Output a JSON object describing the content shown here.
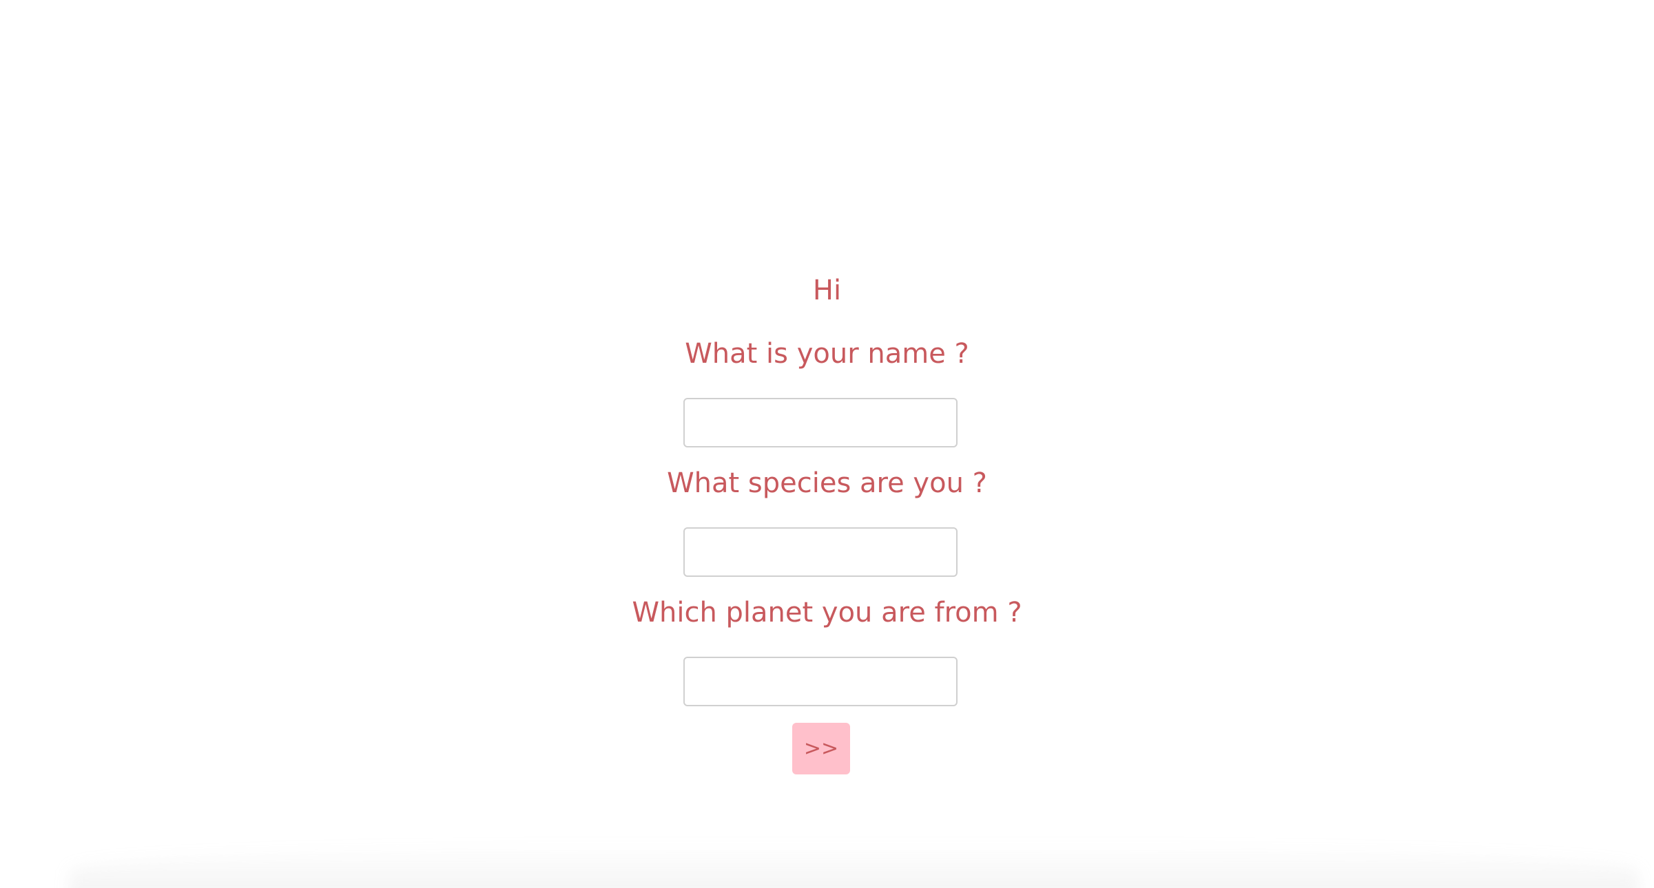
{
  "form": {
    "greeting": "Hi",
    "questions": [
      {
        "label": "What is your name ?",
        "value": "",
        "placeholder": ""
      },
      {
        "label": "What species are you ?",
        "value": "",
        "placeholder": ""
      },
      {
        "label": "Which planet you are from ?",
        "value": "",
        "placeholder": ""
      }
    ],
    "submit_label": ">>"
  },
  "colors": {
    "text": "#c8595d",
    "button_bg": "#ffc0cb",
    "input_border": "#d0d0d0",
    "background": "#ffffff"
  }
}
